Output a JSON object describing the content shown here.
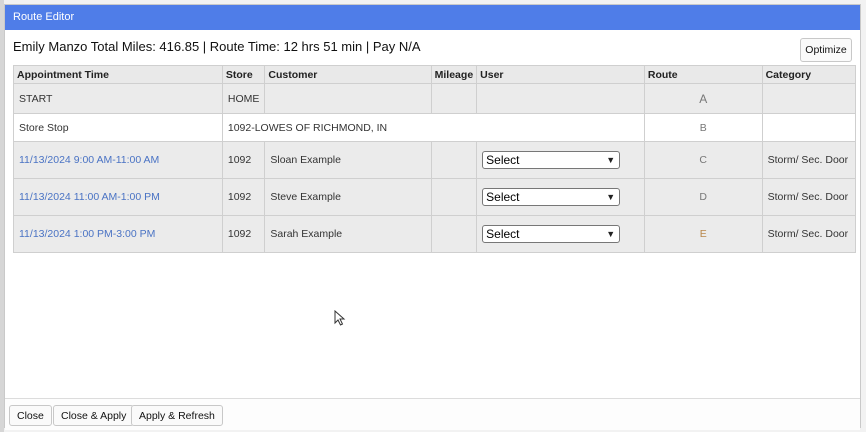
{
  "window": {
    "title": "Route Editor"
  },
  "summary": "Emily Manzo Total Miles: 416.85 | Route Time: 12 hrs 51 min | Pay N/A",
  "toolbar": {
    "optimize_label": "Optimize"
  },
  "table": {
    "columns": [
      "Appointment Time",
      "Store",
      "Customer",
      "Mileage",
      "User",
      "Route",
      "Category"
    ],
    "start": {
      "label": "START",
      "store": "HOME",
      "route": "A"
    },
    "store_stop": {
      "label": "Store Stop",
      "location": "1092-LOWES OF RICHMOND, IN",
      "route": "B"
    },
    "appointments": [
      {
        "time": "11/13/2024 9:00 AM-11:00 AM",
        "store": "1092",
        "customer": "Sloan Example",
        "user": "Select",
        "route": "C",
        "category": "Storm/ Sec. Door"
      },
      {
        "time": "11/13/2024 11:00 AM-1:00 PM",
        "store": "1092",
        "customer": "Steve Example",
        "user": "Select",
        "route": "D",
        "category": "Storm/ Sec. Door"
      },
      {
        "time": "11/13/2024 1:00 PM-3:00 PM",
        "store": "1092",
        "customer": "Sarah Example",
        "user": "Select",
        "route": "E",
        "category": "Storm/ Sec. Door"
      }
    ]
  },
  "footer": {
    "close_label": "Close",
    "close_apply_label": "Close & Apply",
    "apply_refresh_label": "Apply & Refresh"
  },
  "colors": {
    "titlebar": "#4f7de8",
    "link": "#4a73c4"
  }
}
